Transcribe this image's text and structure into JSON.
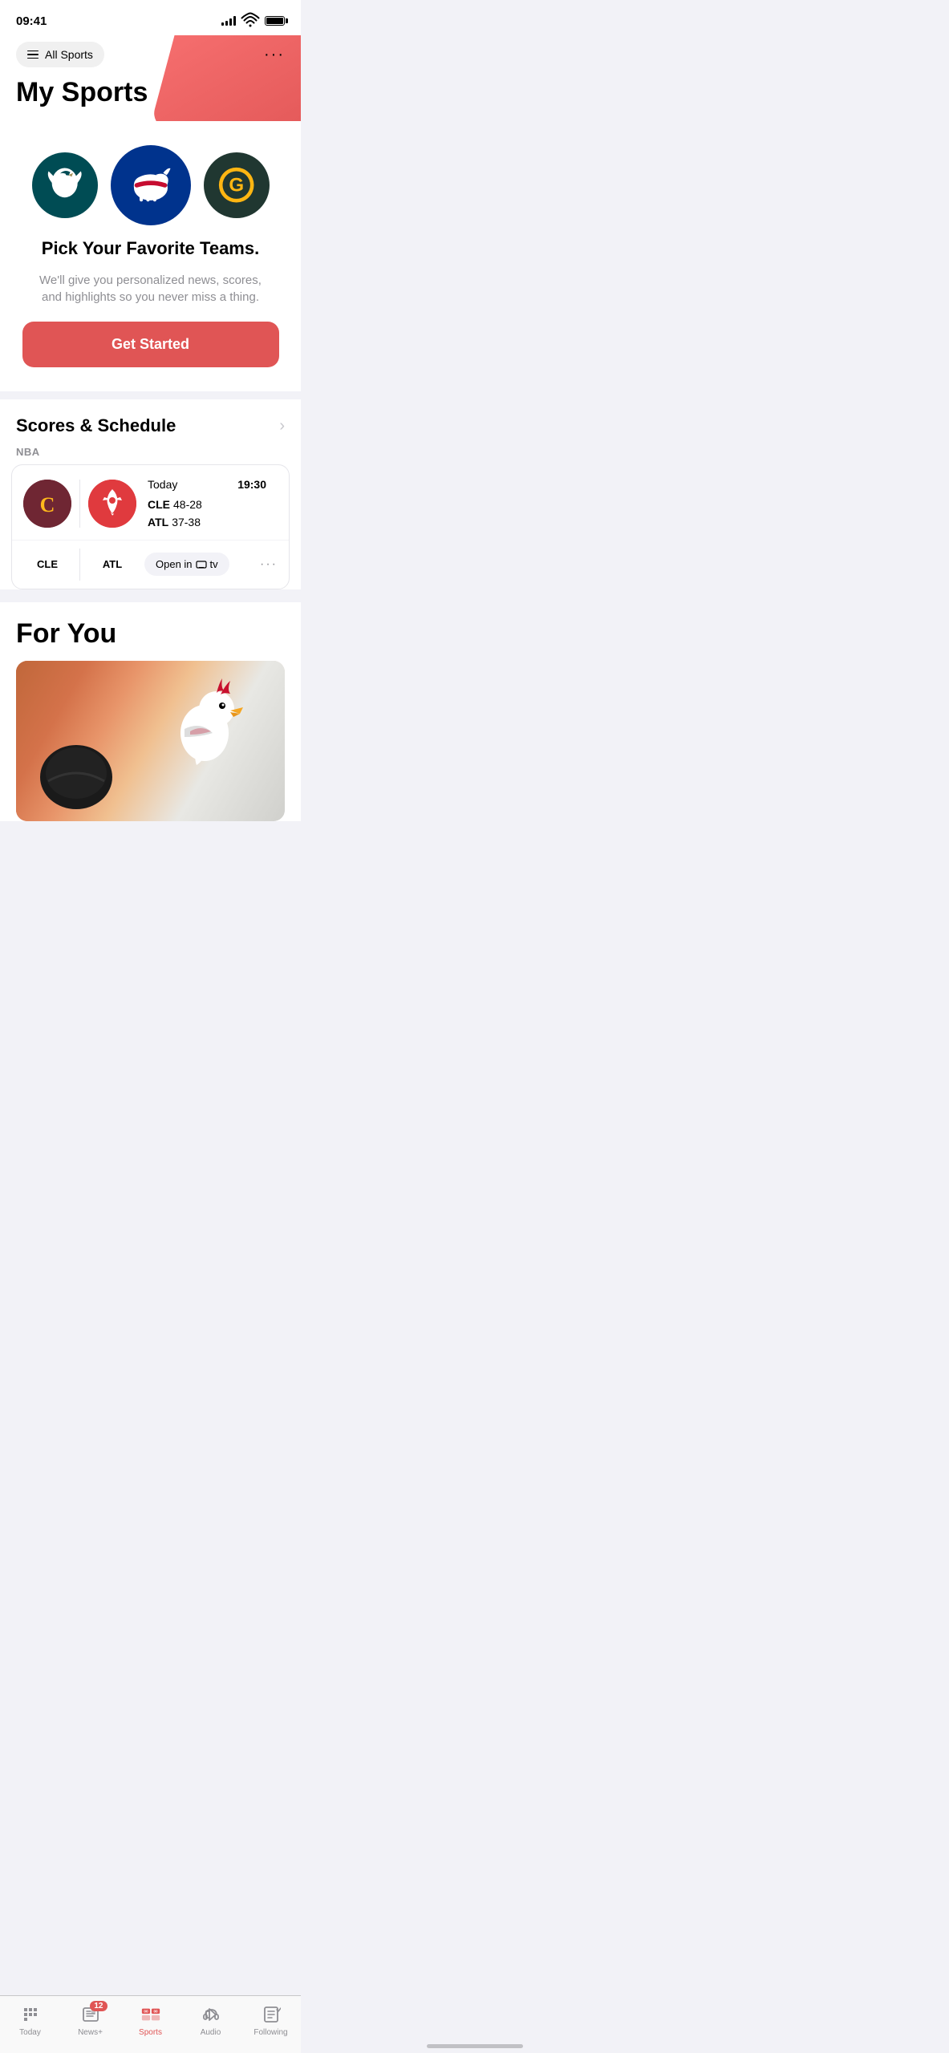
{
  "statusBar": {
    "time": "09:41"
  },
  "header": {
    "allSportsLabel": "All Sports",
    "pageTitle": "My Sports"
  },
  "teamsSection": {
    "pickTeamsTitle": "Pick Your Favorite Teams.",
    "pickTeamsDesc": "We'll give you personalized news, scores, and highlights so you never miss a thing.",
    "getStartedLabel": "Get Started"
  },
  "scoresSection": {
    "title": "Scores & Schedule",
    "league": "NBA",
    "game": {
      "date": "Today",
      "time": "19:30",
      "team1Abbr": "CLE",
      "team1Record": "48-28",
      "team2Abbr": "ATL",
      "team2Record": "37-38",
      "openInTvLabel": "Open in  tv"
    }
  },
  "forYouSection": {
    "title": "For You"
  },
  "tabBar": {
    "tabs": [
      {
        "id": "today",
        "label": "Today",
        "active": false,
        "badge": null
      },
      {
        "id": "newsplus",
        "label": "News+",
        "active": false,
        "badge": "12"
      },
      {
        "id": "sports",
        "label": "Sports",
        "active": true,
        "badge": null
      },
      {
        "id": "audio",
        "label": "Audio",
        "active": false,
        "badge": null
      },
      {
        "id": "following",
        "label": "Following",
        "active": false,
        "badge": null
      }
    ]
  }
}
